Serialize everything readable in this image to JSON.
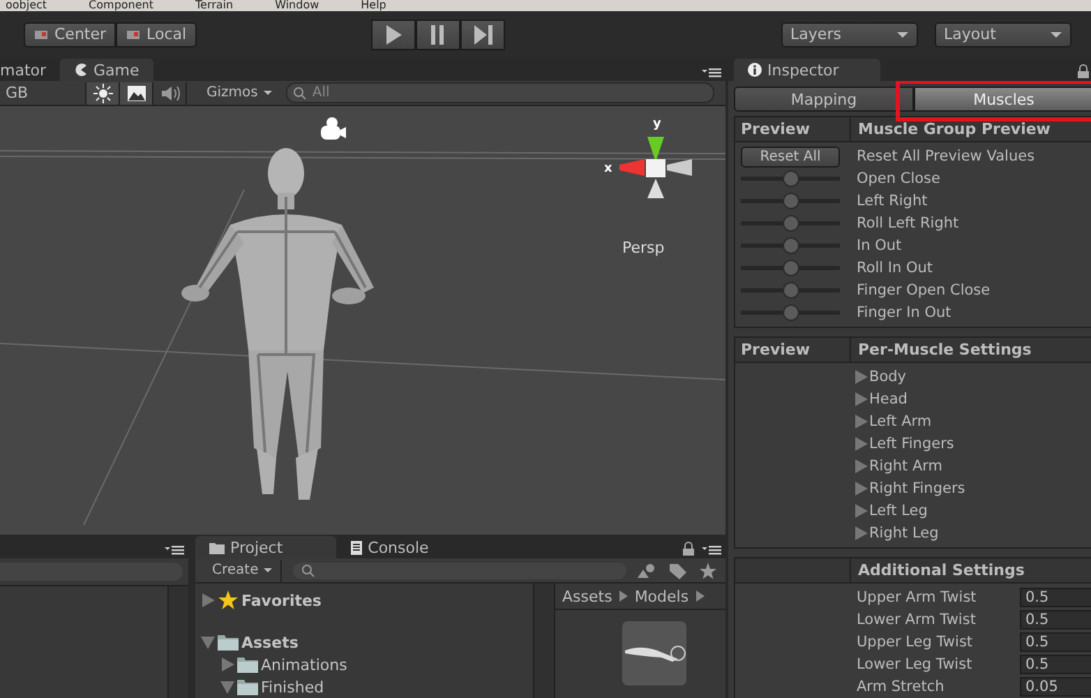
{
  "menu_bar": {
    "items": [
      "oobject",
      "Component",
      "Terrain",
      "Window",
      "Help"
    ]
  },
  "toolbar": {
    "pivot_buttons": [
      "Center",
      "Local"
    ],
    "layers_dropdown": "Layers",
    "layout_dropdown": "Layout"
  },
  "scene_view": {
    "tabs": [
      {
        "label": "mator",
        "selected": false
      },
      {
        "label": "Game",
        "selected": true
      }
    ],
    "shading_dropdown": "GB",
    "toggles": [
      {
        "kind": "lighting",
        "on": true
      },
      {
        "kind": "image",
        "on": true
      },
      {
        "kind": "audio",
        "on": false
      }
    ],
    "gizmos_menu": "Gizmos",
    "search": {
      "placeholder": "All"
    },
    "axis_labels": [
      "y",
      "x"
    ],
    "persp_label": "Persp"
  },
  "project": {
    "tabs": [
      {
        "label": "Project",
        "selected": true
      },
      {
        "label": "Console",
        "selected": false
      }
    ],
    "create_menu": "Create",
    "tree": [
      {
        "label": "Favorites",
        "kind": "favorites",
        "expanded": false
      },
      {
        "label": "Assets",
        "kind": "folder",
        "expanded": true,
        "children": [
          {
            "label": "Animations",
            "kind": "folder",
            "expanded": false
          },
          {
            "label": "Finished",
            "kind": "folder",
            "expanded": true
          }
        ]
      }
    ],
    "breadcrumb": [
      "Assets",
      "Models"
    ]
  },
  "inspector": {
    "tab": "Inspector",
    "mode_tabs": [
      {
        "label": "Mapping",
        "selected": false
      },
      {
        "label": "Muscles",
        "selected": true
      }
    ],
    "muscle_group": {
      "left_header": "Preview",
      "title": "Muscle Group Preview",
      "reset_button": "Reset All",
      "reset_label": "Reset All Preview Values",
      "sliders": [
        {
          "name": "Open Close",
          "level": 0.5
        },
        {
          "name": "Left Right",
          "level": 0.5
        },
        {
          "name": "Roll Left Right",
          "level": 0.5
        },
        {
          "name": "In Out",
          "level": 0.5
        },
        {
          "name": "Roll In Out",
          "level": 0.5
        },
        {
          "name": "Finger Open Close",
          "level": 0.5
        },
        {
          "name": "Finger In Out",
          "level": 0.5
        }
      ]
    },
    "per_muscle": {
      "left_header": "Preview",
      "title": "Per-Muscle Settings",
      "groups": [
        {
          "label": "Body",
          "expanded": false
        },
        {
          "label": "Head",
          "expanded": false
        },
        {
          "label": "Left Arm",
          "expanded": false
        },
        {
          "label": "Left Fingers",
          "expanded": false
        },
        {
          "label": "Right Arm",
          "expanded": false
        },
        {
          "label": "Right Fingers",
          "expanded": false
        },
        {
          "label": "Left Leg",
          "expanded": false
        },
        {
          "label": "Right Leg",
          "expanded": false
        }
      ]
    },
    "additional": {
      "title": "Additional Settings",
      "fields": [
        {
          "label": "Upper Arm Twist",
          "value": "0.5"
        },
        {
          "label": "Lower Arm Twist",
          "value": "0.5"
        },
        {
          "label": "Upper Leg Twist",
          "value": "0.5"
        },
        {
          "label": "Lower Leg Twist",
          "value": "0.5"
        },
        {
          "label": "Arm Stretch",
          "value": "0.05"
        }
      ]
    }
  }
}
